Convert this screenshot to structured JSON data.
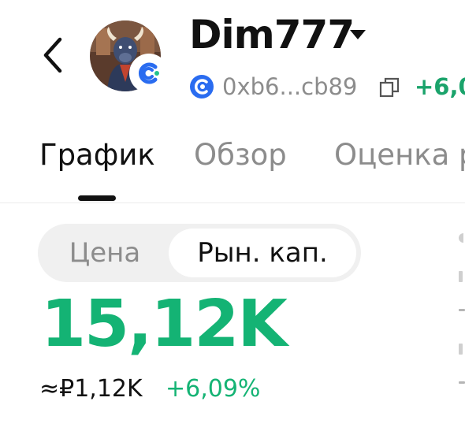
{
  "header": {
    "title": "Dim777",
    "address": "0xb6...cb89",
    "change": "+6,0",
    "back_icon": "chevron-left-icon",
    "avatar": "bull-avatar",
    "dropdown_icon": "caret-down-icon",
    "chain_icon": "chain-logo-icon",
    "copy_icon": "copy-icon"
  },
  "tabs": [
    {
      "label": "График",
      "active": true
    },
    {
      "label": "Обзор",
      "active": false
    },
    {
      "label": "Оценка р",
      "active": false
    }
  ],
  "segment": {
    "options": [
      "Цена",
      "Рын. кап."
    ],
    "selected": "Рын. кап."
  },
  "value": {
    "main": "15,12K",
    "fiat": "≈₽1,12K",
    "change": "+6,09%"
  },
  "colors": {
    "positive": "#14b374",
    "muted": "#8c8c8c",
    "text": "#111111",
    "chain_blue": "#2a6cf0"
  }
}
